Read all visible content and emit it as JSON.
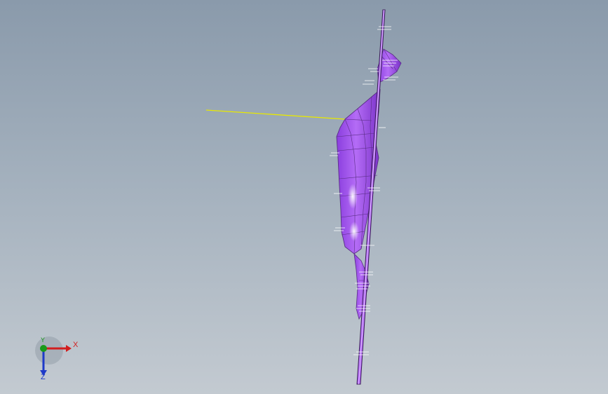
{
  "viewport": {
    "background_top": "#8a9aab",
    "background_bottom": "#c3cad1"
  },
  "model": {
    "surface_color": "#a050ee",
    "edge_color": "#5a2e86",
    "highlight_color": "#f4e8ff",
    "sketch_line_color": "#e8e800"
  },
  "triad": {
    "x_label": "X",
    "y_label": "Y",
    "z_label": "Z",
    "x_color": "#d21e1e",
    "y_color": "#1a9a1a",
    "z_color": "#1e3ac8"
  }
}
